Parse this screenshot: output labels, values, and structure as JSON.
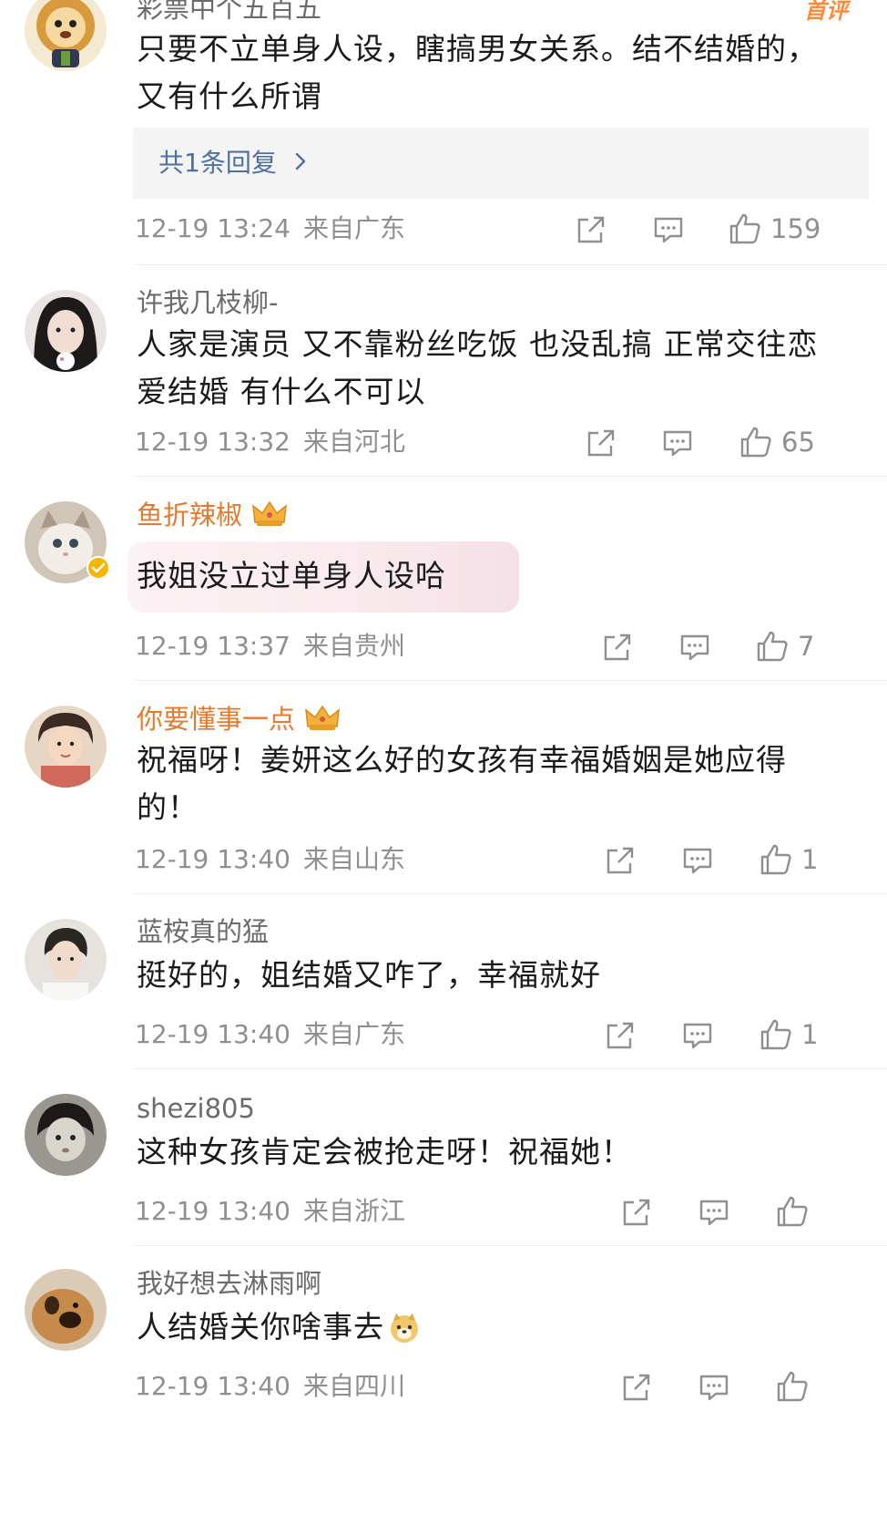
{
  "comments": [
    {
      "username": "彩票中个五百五",
      "badge": "首评",
      "text": "只要不立单身人设，瞎搞男女关系。结不结婚的，又有什么所谓",
      "reply_link": "共1条回复",
      "time": "12-19 13:24",
      "location": "来自广东",
      "likes": "159"
    },
    {
      "username": "许我几枝柳-",
      "text": "人家是演员 又不靠粉丝吃饭 也没乱搞 正常交往恋爱结婚 有什么不可以",
      "time": "12-19 13:32",
      "location": "来自河北",
      "likes": "65"
    },
    {
      "username": "鱼折辣椒",
      "text": "我姐没立过单身人设哈",
      "time": "12-19 13:37",
      "location": "来自贵州",
      "likes": "7"
    },
    {
      "username": "你要懂事一点",
      "text": "祝福呀！姜妍这么好的女孩有幸福婚姻是她应得的！",
      "time": "12-19 13:40",
      "location": "来自山东",
      "likes": "1"
    },
    {
      "username": "蓝桉真的猛",
      "text": "挺好的，姐结婚又咋了，幸福就好",
      "time": "12-19 13:40",
      "location": "来自广东",
      "likes": "1"
    },
    {
      "username": "shezi805",
      "text": "这种女孩肯定会被抢走呀！祝福她！",
      "time": "12-19 13:40",
      "location": "来自浙江",
      "likes": ""
    },
    {
      "username": "我好想去淋雨啊",
      "text": "人结婚关你啥事去",
      "time": "12-19 13:40",
      "location": "来自四川",
      "likes": ""
    }
  ],
  "icons": {
    "share": "share-icon",
    "comment": "comment-icon",
    "like": "thumbs-up-icon",
    "crown": "crown-badge-icon",
    "emoji": "doge-emoji-icon",
    "chevron": "chevron-right-icon"
  },
  "colors": {
    "username": "#6b6b6b",
    "vip_username": "#e57a2e",
    "reply_link": "#4f6fa1",
    "meta": "#8f8f8f",
    "badge": "#ff8a3c"
  }
}
